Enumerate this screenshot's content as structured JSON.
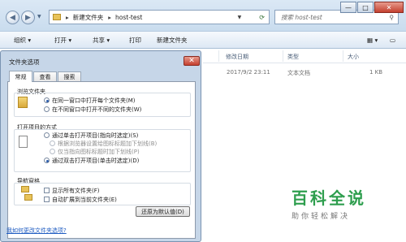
{
  "window_controls": {
    "minimize": "—",
    "maximize": "□",
    "close": "✕"
  },
  "address": {
    "seg1": "新建文件夹",
    "sep": "▸",
    "seg2": "host-test"
  },
  "search": {
    "placeholder": "搜索 host-test"
  },
  "toolbar": {
    "organize": "组织 ▾",
    "open": "打开 ▾",
    "share": "共享 ▾",
    "print": "打印",
    "newfolder": "新建文件夹"
  },
  "columns": {
    "date": "修改日期",
    "type": "类型",
    "size": "大小"
  },
  "file_row": {
    "date": "2017/9/2 23:11",
    "type": "文本文档",
    "size": "1 KB"
  },
  "dialog": {
    "title": "文件夹选项",
    "close": "✕",
    "tabs": [
      "常规",
      "查看",
      "搜索"
    ],
    "browse": {
      "title": "浏览文件夹",
      "opt1": "在同一窗口中打开每个文件夹(M)",
      "opt2": "在不同窗口中打开不同的文件夹(W)"
    },
    "click": {
      "title": "打开项目的方式",
      "opt1": "通过单击打开项目(指向时选定)(S)",
      "sub1": "根据浏览器设置给图标标题加下划线(B)",
      "sub2": "仅当指向图标标题时加下划线(P)",
      "opt2": "通过双击打开项目(单击时选定)(D)"
    },
    "nav": {
      "title": "导航窗格",
      "opt1": "显示所有文件夹(F)",
      "opt2": "自动扩展到当前文件夹(E)"
    },
    "restore": "还原为默认值(D)",
    "link": "我如何更改文件夹选项?"
  },
  "watermark": {
    "title": "百科全说",
    "subtitle": "助你轻松解决"
  }
}
